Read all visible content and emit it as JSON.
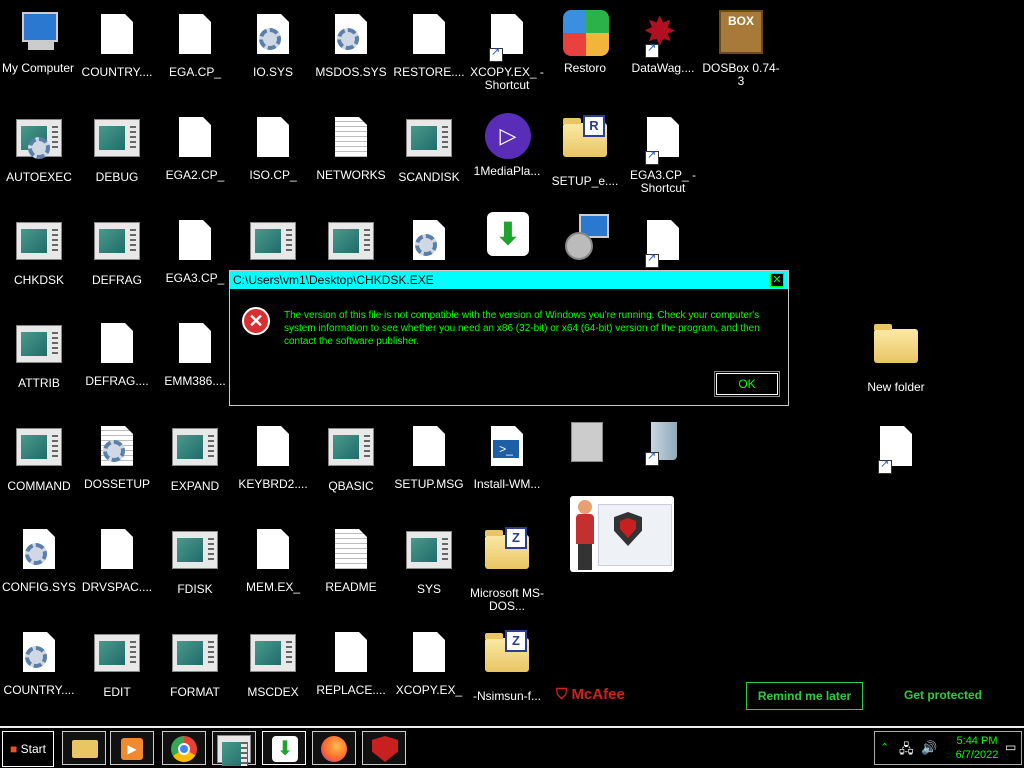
{
  "desktop": {
    "icons": [
      {
        "label": "My Computer"
      },
      {
        "label": "COUNTRY...."
      },
      {
        "label": "EGA.CP_"
      },
      {
        "label": "IO.SYS"
      },
      {
        "label": "MSDOS.SYS"
      },
      {
        "label": "RESTORE...."
      },
      {
        "label": "XCOPY.EX_ - Shortcut"
      },
      {
        "label": "Restoro"
      },
      {
        "label": "DataWag...."
      },
      {
        "label": "DOSBox 0.74-3"
      },
      {
        "label": "AUTOEXEC"
      },
      {
        "label": "DEBUG"
      },
      {
        "label": "EGA2.CP_"
      },
      {
        "label": "ISO.CP_"
      },
      {
        "label": "NETWORKS"
      },
      {
        "label": "SCANDISK"
      },
      {
        "label": "1MediaPla..."
      },
      {
        "label": "SETUP_e...."
      },
      {
        "label": "EGA3.CP_ - Shortcut"
      },
      {
        "label": "CHKDSK"
      },
      {
        "label": "DEFRAG"
      },
      {
        "label": "EGA3.CP_"
      },
      {
        "label": "ATTRIB"
      },
      {
        "label": "DEFRAG...."
      },
      {
        "label": "EMM386...."
      },
      {
        "label": "New folder"
      },
      {
        "label": "COMMAND"
      },
      {
        "label": "DOSSETUP"
      },
      {
        "label": "EXPAND"
      },
      {
        "label": "KEYBRD2...."
      },
      {
        "label": "QBASIC"
      },
      {
        "label": "SETUP.MSG"
      },
      {
        "label": "Install-WM..."
      },
      {
        "label": "CONFIG.SYS"
      },
      {
        "label": "DRVSPAC...."
      },
      {
        "label": "FDISK"
      },
      {
        "label": "MEM.EX_"
      },
      {
        "label": "README"
      },
      {
        "label": "SYS"
      },
      {
        "label": "Microsoft MS-DOS..."
      },
      {
        "label": "COUNTRY...."
      },
      {
        "label": "EDIT"
      },
      {
        "label": "FORMAT"
      },
      {
        "label": "MSCDEX"
      },
      {
        "label": "REPLACE...."
      },
      {
        "label": "XCOPY.EX_"
      },
      {
        "label": "-Nsimsun-f..."
      }
    ]
  },
  "dialog": {
    "title": "C:\\Users\\vm1\\Desktop\\CHKDSK.EXE",
    "message": "The version of this file is not compatible with the version of Windows you're running. Check your computer's system information to see whether you need an x86 (32-bit) or x64 (64-bit) version of the program, and then contact the software publisher.",
    "ok_label": "OK",
    "close_glyph": "✕",
    "icon_glyph": "✕"
  },
  "ad": {
    "brand": "McAfee",
    "remind_label": "Remind me later",
    "protect_label": "Get protected"
  },
  "taskbar": {
    "start_label": "Start",
    "time": "5:44 PM",
    "date": "6/7/2022"
  },
  "colors": {
    "dialog_title_bg": "#00ffff",
    "dialog_text": "#00ff00",
    "ad_green": "#2ecc40",
    "mcafee_red": "#d02020"
  }
}
